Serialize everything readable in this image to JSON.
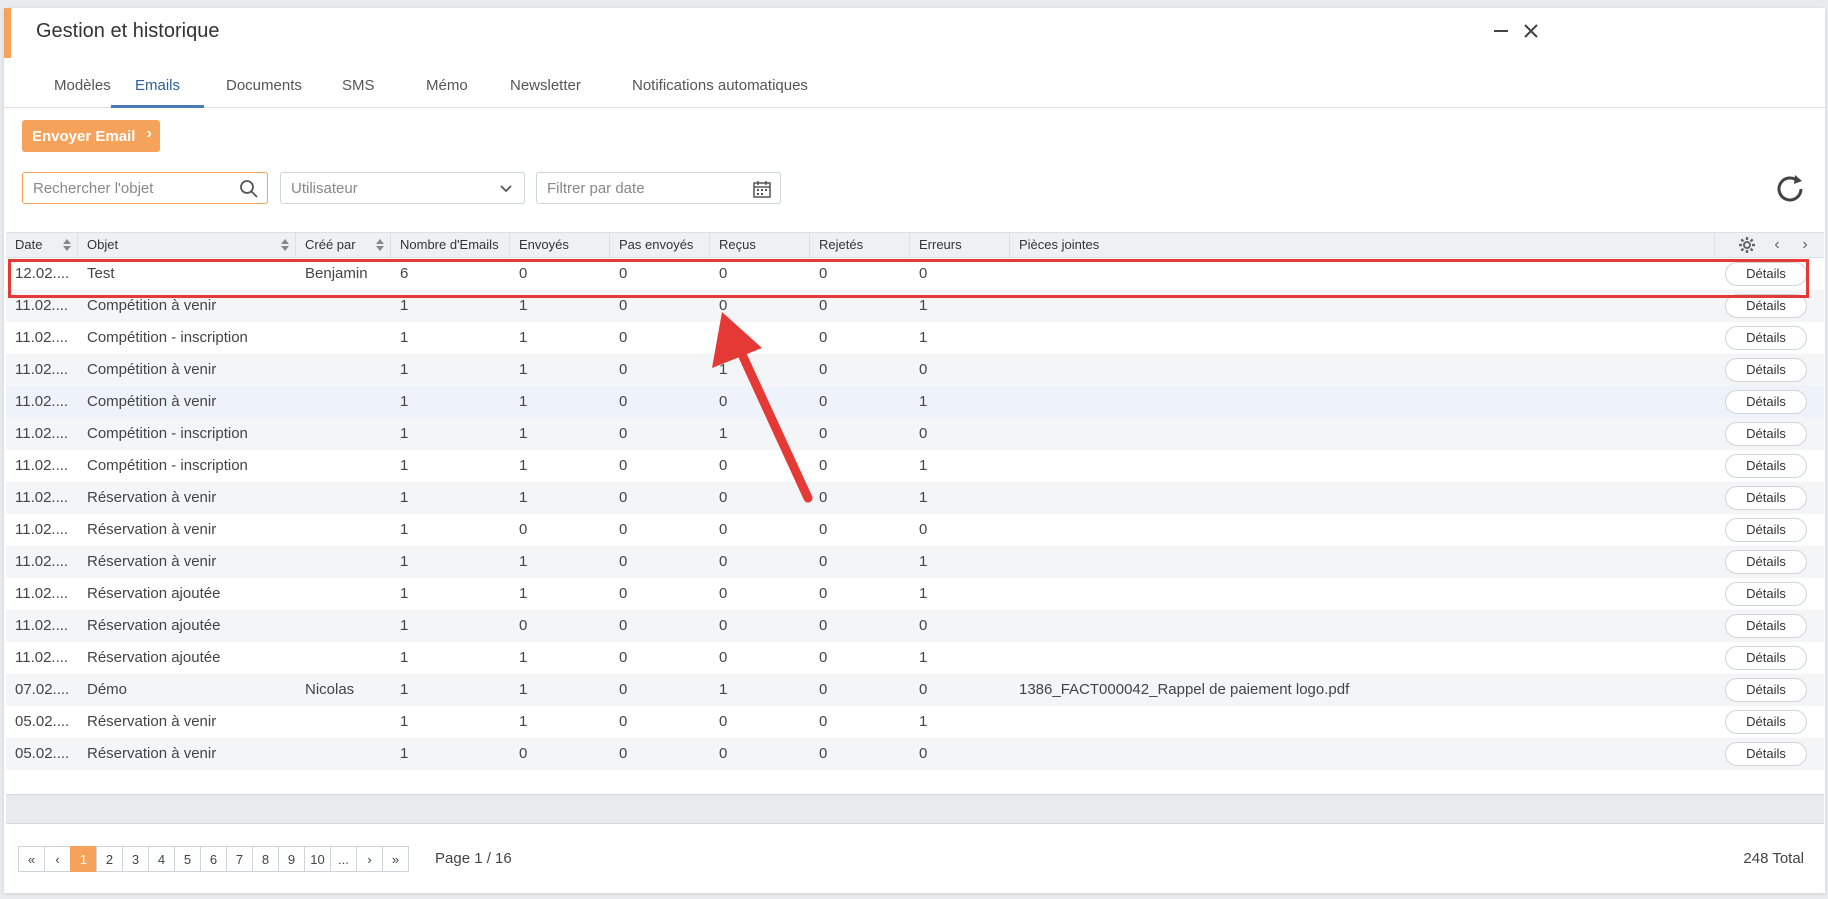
{
  "window": {
    "title": "Gestion et historique"
  },
  "tabs": [
    {
      "label": "Modèles"
    },
    {
      "label": "Emails"
    },
    {
      "label": "Documents"
    },
    {
      "label": "SMS"
    },
    {
      "label": "Mémo"
    },
    {
      "label": "Newsletter"
    },
    {
      "label": "Notifications automatiques"
    }
  ],
  "active_tab": "Emails",
  "toolbar": {
    "send_label": "Envoyer Email"
  },
  "filters": {
    "search_placeholder": "Rechercher l'objet",
    "user_placeholder": "Utilisateur",
    "date_placeholder": "Filtrer par date"
  },
  "table": {
    "headers": {
      "date": "Date",
      "objet": "Objet",
      "cree_par": "Créé par",
      "nombre": "Nombre d'Emails",
      "envoyes": "Envoyés",
      "pas_envoyes": "Pas envoyés",
      "recus": "Reçus",
      "rejetes": "Rejetés",
      "erreurs": "Erreurs",
      "pieces": "Pièces jointes"
    },
    "details_label": "Détails",
    "rows": [
      {
        "date": "12.02....",
        "objet": "Test",
        "cree_par": "Benjamin",
        "nombre": "6",
        "envoyes": "0",
        "pas_envoyes": "0",
        "recus": "0",
        "rejetes": "0",
        "erreurs": "0",
        "pieces": ""
      },
      {
        "date": "11.02....",
        "objet": "Compétition à venir",
        "cree_par": "",
        "nombre": "1",
        "envoyes": "1",
        "pas_envoyes": "0",
        "recus": "0",
        "rejetes": "0",
        "erreurs": "1",
        "pieces": ""
      },
      {
        "date": "11.02....",
        "objet": "Compétition - inscription",
        "cree_par": "",
        "nombre": "1",
        "envoyes": "1",
        "pas_envoyes": "0",
        "recus": "0",
        "rejetes": "0",
        "erreurs": "1",
        "pieces": ""
      },
      {
        "date": "11.02....",
        "objet": "Compétition à venir",
        "cree_par": "",
        "nombre": "1",
        "envoyes": "1",
        "pas_envoyes": "0",
        "recus": "1",
        "rejetes": "0",
        "erreurs": "0",
        "pieces": ""
      },
      {
        "date": "11.02....",
        "objet": "Compétition à venir",
        "cree_par": "",
        "nombre": "1",
        "envoyes": "1",
        "pas_envoyes": "0",
        "recus": "0",
        "rejetes": "0",
        "erreurs": "1",
        "pieces": ""
      },
      {
        "date": "11.02....",
        "objet": "Compétition - inscription",
        "cree_par": "",
        "nombre": "1",
        "envoyes": "1",
        "pas_envoyes": "0",
        "recus": "1",
        "rejetes": "0",
        "erreurs": "0",
        "pieces": ""
      },
      {
        "date": "11.02....",
        "objet": "Compétition - inscription",
        "cree_par": "",
        "nombre": "1",
        "envoyes": "1",
        "pas_envoyes": "0",
        "recus": "0",
        "rejetes": "0",
        "erreurs": "1",
        "pieces": ""
      },
      {
        "date": "11.02....",
        "objet": "Réservation à venir",
        "cree_par": "",
        "nombre": "1",
        "envoyes": "1",
        "pas_envoyes": "0",
        "recus": "0",
        "rejetes": "0",
        "erreurs": "1",
        "pieces": ""
      },
      {
        "date": "11.02....",
        "objet": "Réservation à venir",
        "cree_par": "",
        "nombre": "1",
        "envoyes": "0",
        "pas_envoyes": "0",
        "recus": "0",
        "rejetes": "0",
        "erreurs": "0",
        "pieces": ""
      },
      {
        "date": "11.02....",
        "objet": "Réservation à venir",
        "cree_par": "",
        "nombre": "1",
        "envoyes": "1",
        "pas_envoyes": "0",
        "recus": "0",
        "rejetes": "0",
        "erreurs": "1",
        "pieces": ""
      },
      {
        "date": "11.02....",
        "objet": "Réservation ajoutée",
        "cree_par": "",
        "nombre": "1",
        "envoyes": "1",
        "pas_envoyes": "0",
        "recus": "0",
        "rejetes": "0",
        "erreurs": "1",
        "pieces": ""
      },
      {
        "date": "11.02....",
        "objet": "Réservation ajoutée",
        "cree_par": "",
        "nombre": "1",
        "envoyes": "0",
        "pas_envoyes": "0",
        "recus": "0",
        "rejetes": "0",
        "erreurs": "0",
        "pieces": ""
      },
      {
        "date": "11.02....",
        "objet": "Réservation ajoutée",
        "cree_par": "",
        "nombre": "1",
        "envoyes": "1",
        "pas_envoyes": "0",
        "recus": "0",
        "rejetes": "0",
        "erreurs": "1",
        "pieces": ""
      },
      {
        "date": "07.02....",
        "objet": "Démo",
        "cree_par": "Nicolas",
        "nombre": "1",
        "envoyes": "1",
        "pas_envoyes": "0",
        "recus": "1",
        "rejetes": "0",
        "erreurs": "0",
        "pieces": "1386_FACT000042_Rappel de paiement logo.pdf"
      },
      {
        "date": "05.02....",
        "objet": "Réservation à venir",
        "cree_par": "",
        "nombre": "1",
        "envoyes": "1",
        "pas_envoyes": "0",
        "recus": "0",
        "rejetes": "0",
        "erreurs": "1",
        "pieces": ""
      },
      {
        "date": "05.02....",
        "objet": "Réservation à venir",
        "cree_par": "",
        "nombre": "1",
        "envoyes": "0",
        "pas_envoyes": "0",
        "recus": "0",
        "rejetes": "0",
        "erreurs": "0",
        "pieces": ""
      }
    ]
  },
  "pagination": {
    "pages": [
      "1",
      "2",
      "3",
      "4",
      "5",
      "6",
      "7",
      "8",
      "9",
      "10",
      "..."
    ],
    "current_page": "1",
    "page_info": "Page 1 / 16",
    "total": "248 Total"
  },
  "colors": {
    "accent": "#f5a25a",
    "active_tab": "#4a7ab5",
    "highlight": "#e53935"
  },
  "icons": [
    "minimize-icon",
    "close-icon",
    "chevron-right-icon",
    "search-icon",
    "chevron-down-icon",
    "calendar-icon",
    "refresh-icon",
    "sort-icon",
    "gear-icon",
    "chevron-left-icon",
    "first-page-icon",
    "last-page-icon",
    "annotation-arrow"
  ]
}
